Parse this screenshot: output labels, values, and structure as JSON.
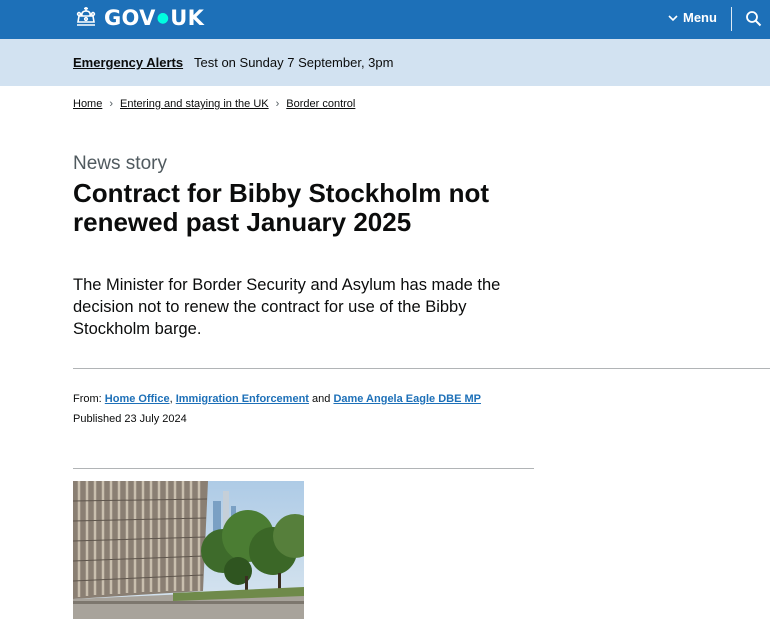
{
  "header": {
    "logo_text": "GOV",
    "logo_text_2": "UK",
    "menu_label": "Menu",
    "brand_color": "#1d70b8",
    "icons": [
      "crown-icon",
      "chevron-down-icon",
      "search-icon"
    ]
  },
  "alert": {
    "link": "Emergency Alerts",
    "text": "Test on Sunday 7 September, 3pm"
  },
  "breadcrumb": [
    {
      "label": "Home"
    },
    {
      "label": "Entering and staying in the UK"
    },
    {
      "label": "Border control"
    }
  ],
  "article": {
    "caption": "News story",
    "title": "Contract for Bibby Stockholm not renewed past January 2025",
    "lead": "The Minister for Border Security and Asylum has made the decision not to renew the contract for use of the Bibby Stockholm barge.",
    "from_label": "From:",
    "organisations": [
      "Home Office",
      "Immigration Enforcement",
      "Dame Angela Eagle DBE MP"
    ],
    "from_sep": ",",
    "from_and": "and",
    "published_label": "Published",
    "published_date": "23 July 2024"
  }
}
